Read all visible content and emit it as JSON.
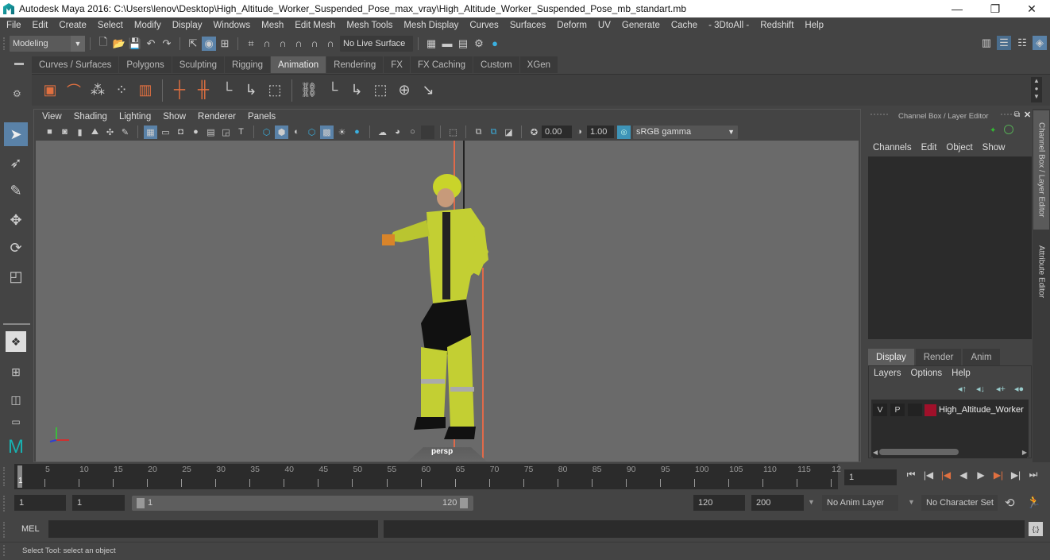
{
  "window": {
    "title": "Autodesk Maya 2016: C:\\Users\\lenov\\Desktop\\High_Altitude_Worker_Suspended_Pose_max_vray\\High_Altitude_Worker_Suspended_Pose_mb_standart.mb",
    "controls": {
      "minimize": "—",
      "restore": "❐",
      "close": "✕"
    }
  },
  "menubar": [
    "File",
    "Edit",
    "Create",
    "Select",
    "Modify",
    "Display",
    "Windows",
    "Mesh",
    "Edit Mesh",
    "Mesh Tools",
    "Mesh Display",
    "Curves",
    "Surfaces",
    "Deform",
    "UV",
    "Generate",
    "Cache",
    "- 3DtoAll -",
    "Redshift",
    "Help"
  ],
  "statusline": {
    "menuset": "Modeling",
    "live_surface": "No Live Surface"
  },
  "shelf": {
    "tabs": [
      "Curves / Surfaces",
      "Polygons",
      "Sculpting",
      "Rigging",
      "Animation",
      "Rendering",
      "FX",
      "FX Caching",
      "Custom",
      "XGen"
    ],
    "active_tab": "Animation",
    "icons": [
      "playblast-icon",
      "motion-trail-icon",
      "ghost-icon",
      "unghost-icon",
      "create-clip-icon",
      "set-key-icon",
      "set-breakdown-icon",
      "joint-icon",
      "ik-handle-icon",
      "bind-skin-icon",
      "parent-constraint-icon",
      "point-constraint-icon",
      "orient-constraint-icon",
      "scale-constraint-icon",
      "aim-constraint-icon",
      "pole-vector-icon"
    ]
  },
  "viewport": {
    "menu": [
      "View",
      "Shading",
      "Lighting",
      "Show",
      "Renderer",
      "Panels"
    ],
    "exposure": "0.00",
    "gamma": "1.00",
    "color_space": "sRGB gamma",
    "camera_label": "persp",
    "axis": {
      "x": "x",
      "y": "y",
      "z": "z"
    }
  },
  "channel_box": {
    "title": "Channel Box / Layer Editor",
    "menu": [
      "Channels",
      "Edit",
      "Object",
      "Show"
    ]
  },
  "layer_editor": {
    "tabs": [
      "Display",
      "Render",
      "Anim"
    ],
    "active_tab": "Display",
    "menu": [
      "Layers",
      "Options",
      "Help"
    ],
    "layers": [
      {
        "v": "V",
        "p": "P",
        "name": "High_Altitude_Worker",
        "color": "#a0102a"
      }
    ]
  },
  "side_tabs": [
    "Channel Box / Layer Editor",
    "Attribute Editor"
  ],
  "timeline": {
    "start_label": "1",
    "ticks": [
      5,
      10,
      15,
      20,
      25,
      30,
      35,
      40,
      45,
      50,
      55,
      60,
      65,
      70,
      75,
      80,
      85,
      90,
      95,
      100,
      105,
      110,
      115,
      "12"
    ],
    "current_frame": "1"
  },
  "range": {
    "start": "1",
    "playback_start": "1",
    "slider_start": "1",
    "slider_end": "120",
    "playback_end": "120",
    "end": "200",
    "anim_layer": "No Anim Layer",
    "character_set": "No Character Set"
  },
  "command_line": {
    "label": "MEL",
    "value": ""
  },
  "help_line": "Select Tool: select an object"
}
